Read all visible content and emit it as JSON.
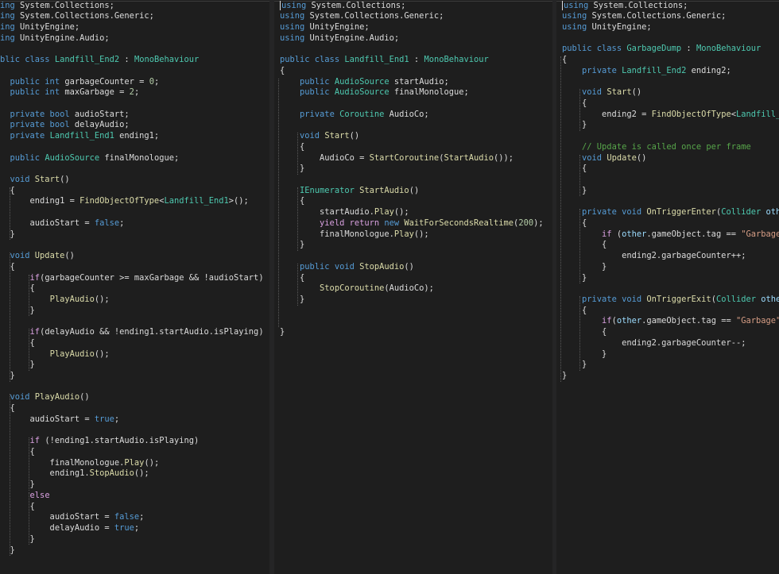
{
  "colors": {
    "background": "#1e1e1e",
    "keyword": "#569cd6",
    "control": "#d8a0df",
    "type": "#4ec9b0",
    "method": "#dcdcaa",
    "string": "#d69d85",
    "number": "#b5cea8",
    "comment": "#57a64a",
    "plain": "#dcdcdc",
    "identifier": "#9cdcfe"
  },
  "panes": [
    {
      "id": "left",
      "lines": [
        [
          [
            "kw",
            "ing"
          ],
          [
            "pl",
            " System.Collections;"
          ]
        ],
        [
          [
            "kw",
            "ing"
          ],
          [
            "pl",
            " System.Collections.Generic;"
          ]
        ],
        [
          [
            "kw",
            "ing"
          ],
          [
            "pl",
            " UnityEngine;"
          ]
        ],
        [
          [
            "kw",
            "ing"
          ],
          [
            "pl",
            " UnityEngine.Audio;"
          ]
        ],
        [],
        [
          [
            "kw",
            "blic class "
          ],
          [
            "ty",
            "Landfill_End2"
          ],
          [
            "pl",
            " : "
          ],
          [
            "ty",
            "MonoBehaviour"
          ]
        ],
        [],
        [
          [
            "pl",
            "  "
          ],
          [
            "kw",
            "public int"
          ],
          [
            "pl",
            " garbageCounter = "
          ],
          [
            "num",
            "0"
          ],
          [
            "pl",
            ";"
          ]
        ],
        [
          [
            "pl",
            "  "
          ],
          [
            "kw",
            "public int"
          ],
          [
            "pl",
            " maxGarbage = "
          ],
          [
            "num",
            "2"
          ],
          [
            "pl",
            ";"
          ]
        ],
        [],
        [
          [
            "pl",
            "  "
          ],
          [
            "kw",
            "private bool"
          ],
          [
            "pl",
            " audioStart;"
          ]
        ],
        [
          [
            "pl",
            "  "
          ],
          [
            "kw",
            "private bool"
          ],
          [
            "pl",
            " delayAudio;"
          ]
        ],
        [
          [
            "pl",
            "  "
          ],
          [
            "kw",
            "private "
          ],
          [
            "ty",
            "Landfill_End1"
          ],
          [
            "pl",
            " ending1;"
          ]
        ],
        [],
        [
          [
            "pl",
            "  "
          ],
          [
            "kw",
            "public "
          ],
          [
            "ty",
            "AudioSource"
          ],
          [
            "pl",
            " finalMonologue;"
          ]
        ],
        [],
        [
          [
            "pl",
            "  "
          ],
          [
            "kw",
            "void "
          ],
          [
            "fn",
            "Start"
          ],
          [
            "pl",
            "()"
          ]
        ],
        [
          [
            "pl",
            "  {"
          ]
        ],
        [
          [
            "pl",
            "      ending1 = "
          ],
          [
            "fn",
            "FindObjectOfType"
          ],
          [
            "pl",
            "<"
          ],
          [
            "ty",
            "Landfill_End1"
          ],
          [
            "pl",
            ">();"
          ]
        ],
        [],
        [
          [
            "pl",
            "      audioStart = "
          ],
          [
            "kw",
            "false"
          ],
          [
            "pl",
            ";"
          ]
        ],
        [
          [
            "pl",
            "  }"
          ]
        ],
        [],
        [
          [
            "pl",
            "  "
          ],
          [
            "kw",
            "void "
          ],
          [
            "fn",
            "Update"
          ],
          [
            "pl",
            "()"
          ]
        ],
        [
          [
            "pl",
            "  {"
          ]
        ],
        [
          [
            "pl",
            "      "
          ],
          [
            "ctl",
            "if"
          ],
          [
            "pl",
            "(garbageCounter >= maxGarbage && !audioStart)"
          ]
        ],
        [
          [
            "pl",
            "      {"
          ]
        ],
        [
          [
            "pl",
            "          "
          ],
          [
            "fn",
            "PlayAudio"
          ],
          [
            "pl",
            "();"
          ]
        ],
        [
          [
            "pl",
            "      }"
          ]
        ],
        [],
        [
          [
            "pl",
            "      "
          ],
          [
            "ctl",
            "if"
          ],
          [
            "pl",
            "(delayAudio && !ending1.startAudio.isPlaying)"
          ]
        ],
        [
          [
            "pl",
            "      {"
          ]
        ],
        [
          [
            "pl",
            "          "
          ],
          [
            "fn",
            "PlayAudio"
          ],
          [
            "pl",
            "();"
          ]
        ],
        [
          [
            "pl",
            "      }"
          ]
        ],
        [
          [
            "pl",
            "  }"
          ]
        ],
        [],
        [
          [
            "pl",
            "  "
          ],
          [
            "kw",
            "void "
          ],
          [
            "fn",
            "PlayAudio"
          ],
          [
            "pl",
            "()"
          ]
        ],
        [
          [
            "pl",
            "  {"
          ]
        ],
        [
          [
            "pl",
            "      audioStart = "
          ],
          [
            "kw",
            "true"
          ],
          [
            "pl",
            ";"
          ]
        ],
        [],
        [
          [
            "pl",
            "      "
          ],
          [
            "ctl",
            "if"
          ],
          [
            "pl",
            " (!ending1.startAudio.isPlaying)"
          ]
        ],
        [
          [
            "pl",
            "      {"
          ]
        ],
        [
          [
            "pl",
            "          finalMonologue."
          ],
          [
            "fn",
            "Play"
          ],
          [
            "pl",
            "();"
          ]
        ],
        [
          [
            "pl",
            "          ending1."
          ],
          [
            "fn",
            "StopAudio"
          ],
          [
            "pl",
            "();"
          ]
        ],
        [
          [
            "pl",
            "      }"
          ]
        ],
        [
          [
            "pl",
            "      "
          ],
          [
            "ctl",
            "else"
          ]
        ],
        [
          [
            "pl",
            "      {"
          ]
        ],
        [
          [
            "pl",
            "          audioStart = "
          ],
          [
            "kw",
            "false"
          ],
          [
            "pl",
            ";"
          ]
        ],
        [
          [
            "pl",
            "          delayAudio = "
          ],
          [
            "kw",
            "true"
          ],
          [
            "pl",
            ";"
          ]
        ],
        [
          [
            "pl",
            "      }"
          ]
        ],
        [
          [
            "pl",
            "  }"
          ]
        ]
      ]
    },
    {
      "id": "middle",
      "lines": [
        [
          [
            "caret",
            ""
          ],
          [
            "kw",
            "using"
          ],
          [
            "pl",
            " System.Collections;"
          ]
        ],
        [
          [
            "kw",
            "using"
          ],
          [
            "pl",
            " System.Collections.Generic;"
          ]
        ],
        [
          [
            "kw",
            "using"
          ],
          [
            "pl",
            " UnityEngine;"
          ]
        ],
        [
          [
            "kw",
            "using"
          ],
          [
            "pl",
            " UnityEngine.Audio;"
          ]
        ],
        [],
        [
          [
            "kw",
            "public class "
          ],
          [
            "ty",
            "Landfill_End1"
          ],
          [
            "pl",
            " : "
          ],
          [
            "ty",
            "MonoBehaviour"
          ]
        ],
        [
          [
            "pl",
            "{"
          ]
        ],
        [
          [
            "pl",
            "    "
          ],
          [
            "kw",
            "public "
          ],
          [
            "ty",
            "AudioSource"
          ],
          [
            "pl",
            " startAudio;"
          ]
        ],
        [
          [
            "pl",
            "    "
          ],
          [
            "kw",
            "public "
          ],
          [
            "ty",
            "AudioSource"
          ],
          [
            "pl",
            " finalMonologue;"
          ]
        ],
        [],
        [
          [
            "pl",
            "    "
          ],
          [
            "kw",
            "private "
          ],
          [
            "ty",
            "Coroutine"
          ],
          [
            "pl",
            " AudioCo;"
          ]
        ],
        [],
        [
          [
            "pl",
            "    "
          ],
          [
            "kw",
            "void "
          ],
          [
            "fn",
            "Start"
          ],
          [
            "pl",
            "()"
          ]
        ],
        [
          [
            "pl",
            "    {"
          ]
        ],
        [
          [
            "pl",
            "        AudioCo = "
          ],
          [
            "fn",
            "StartCoroutine"
          ],
          [
            "pl",
            "("
          ],
          [
            "fn",
            "StartAudio"
          ],
          [
            "pl",
            "());"
          ]
        ],
        [
          [
            "pl",
            "    }"
          ]
        ],
        [],
        [
          [
            "pl",
            "    "
          ],
          [
            "ty",
            "IEnumerator"
          ],
          [
            "pl",
            " "
          ],
          [
            "fn",
            "StartAudio"
          ],
          [
            "pl",
            "()"
          ]
        ],
        [
          [
            "pl",
            "    {"
          ]
        ],
        [
          [
            "pl",
            "        startAudio."
          ],
          [
            "fn",
            "Play"
          ],
          [
            "pl",
            "();"
          ]
        ],
        [
          [
            "pl",
            "        "
          ],
          [
            "ctl",
            "yield return "
          ],
          [
            "kw",
            "new "
          ],
          [
            "fn",
            "WaitForSecondsRealtime"
          ],
          [
            "pl",
            "("
          ],
          [
            "num",
            "200"
          ],
          [
            "pl",
            ");"
          ]
        ],
        [
          [
            "pl",
            "        finalMonologue."
          ],
          [
            "fn",
            "Play"
          ],
          [
            "pl",
            "();"
          ]
        ],
        [
          [
            "pl",
            "    }"
          ]
        ],
        [],
        [
          [
            "pl",
            "    "
          ],
          [
            "kw",
            "public void "
          ],
          [
            "fn",
            "StopAudio"
          ],
          [
            "pl",
            "()"
          ]
        ],
        [
          [
            "pl",
            "    {"
          ]
        ],
        [
          [
            "pl",
            "        "
          ],
          [
            "fn",
            "StopCoroutine"
          ],
          [
            "pl",
            "(AudioCo);"
          ]
        ],
        [
          [
            "pl",
            "    }"
          ]
        ],
        [],
        [],
        [
          [
            "pl",
            "}"
          ]
        ]
      ]
    },
    {
      "id": "right",
      "lines": [
        [
          [
            "caret",
            ""
          ],
          [
            "kw",
            "using"
          ],
          [
            "pl",
            " System.Collections;"
          ]
        ],
        [
          [
            "kw",
            "using"
          ],
          [
            "pl",
            " System.Collections.Generic;"
          ]
        ],
        [
          [
            "kw",
            "using"
          ],
          [
            "pl",
            " UnityEngine;"
          ]
        ],
        [],
        [
          [
            "kw",
            "public class "
          ],
          [
            "ty",
            "GarbageDump"
          ],
          [
            "pl",
            " : "
          ],
          [
            "ty",
            "MonoBehaviour"
          ]
        ],
        [
          [
            "pl",
            "{"
          ]
        ],
        [
          [
            "pl",
            "    "
          ],
          [
            "kw",
            "private "
          ],
          [
            "ty",
            "Landfill_End2"
          ],
          [
            "pl",
            " ending2;"
          ]
        ],
        [],
        [
          [
            "pl",
            "    "
          ],
          [
            "kw",
            "void "
          ],
          [
            "fn",
            "Start"
          ],
          [
            "pl",
            "()"
          ]
        ],
        [
          [
            "pl",
            "    {"
          ]
        ],
        [
          [
            "pl",
            "        ending2 = "
          ],
          [
            "fn",
            "FindObjectOfType"
          ],
          [
            "pl",
            "<"
          ],
          [
            "ty",
            "Landfill_End"
          ]
        ],
        [
          [
            "pl",
            "    }"
          ]
        ],
        [],
        [
          [
            "pl",
            "    "
          ],
          [
            "cm",
            "// Update is called once per frame"
          ]
        ],
        [
          [
            "pl",
            "    "
          ],
          [
            "kw",
            "void "
          ],
          [
            "fn",
            "Update"
          ],
          [
            "pl",
            "()"
          ]
        ],
        [
          [
            "pl",
            "    {"
          ]
        ],
        [],
        [
          [
            "pl",
            "    }"
          ]
        ],
        [],
        [
          [
            "pl",
            "    "
          ],
          [
            "kw",
            "private void "
          ],
          [
            "fn",
            "OnTriggerEnter"
          ],
          [
            "pl",
            "("
          ],
          [
            "ty",
            "Collider"
          ],
          [
            "pl",
            " "
          ],
          [
            "id",
            "other"
          ]
        ],
        [
          [
            "pl",
            "    {"
          ]
        ],
        [
          [
            "pl",
            "        "
          ],
          [
            "ctl",
            "if"
          ],
          [
            "pl",
            " ("
          ],
          [
            "id",
            "other"
          ],
          [
            "pl",
            ".gameObject.tag == "
          ],
          [
            "str",
            "\"Garbage\""
          ],
          [
            "pl",
            ")"
          ]
        ],
        [
          [
            "pl",
            "        {"
          ]
        ],
        [
          [
            "pl",
            "            ending2.garbageCounter++;"
          ]
        ],
        [
          [
            "pl",
            "        }"
          ]
        ],
        [
          [
            "pl",
            "    }"
          ]
        ],
        [],
        [
          [
            "pl",
            "    "
          ],
          [
            "kw",
            "private void "
          ],
          [
            "fn",
            "OnTriggerExit"
          ],
          [
            "pl",
            "("
          ],
          [
            "ty",
            "Collider"
          ],
          [
            "pl",
            " "
          ],
          [
            "id",
            "other"
          ],
          [
            "pl",
            ")"
          ]
        ],
        [
          [
            "pl",
            "    {"
          ]
        ],
        [
          [
            "pl",
            "        "
          ],
          [
            "ctl",
            "if"
          ],
          [
            "pl",
            "("
          ],
          [
            "id",
            "other"
          ],
          [
            "pl",
            ".gameObject.tag == "
          ],
          [
            "str",
            "\"Garbage\""
          ],
          [
            "pl",
            ")"
          ]
        ],
        [
          [
            "pl",
            "        {"
          ]
        ],
        [
          [
            "pl",
            "            ending2.garbageCounter--;"
          ]
        ],
        [
          [
            "pl",
            "        }"
          ]
        ],
        [
          [
            "pl",
            "    }"
          ]
        ],
        [
          [
            "pl",
            "}"
          ]
        ]
      ]
    }
  ]
}
